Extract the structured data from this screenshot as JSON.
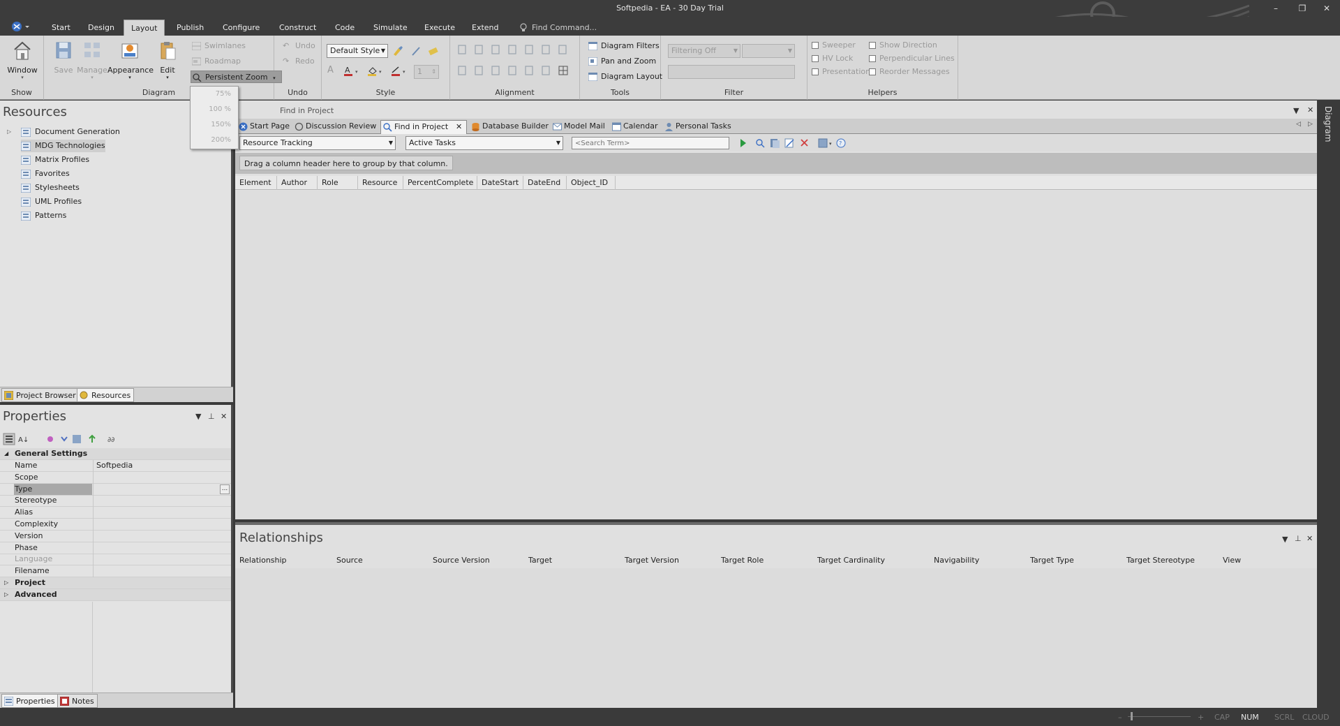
{
  "window": {
    "title": "Softpedia - EA - 30 Day Trial",
    "minimize": "–",
    "restore": "❐",
    "close": "✕"
  },
  "ribbon_tabs": [
    "Start",
    "Design",
    "Layout",
    "Publish",
    "Configure",
    "Construct",
    "Code",
    "Simulate",
    "Execute",
    "Extend"
  ],
  "find_command": "Find Command...",
  "ribbon": {
    "show": {
      "window": "Window",
      "label": "Show"
    },
    "diagram": {
      "save": "Save",
      "manage": "Manage",
      "appearance": "Appearance",
      "edit": "Edit",
      "swimlanes": "Swimlanes",
      "roadmap": "Roadmap",
      "persistent_zoom": "Persistent Zoom",
      "label": "Diagram"
    },
    "undo": {
      "undo": "Undo",
      "redo": "Redo",
      "label": "Undo"
    },
    "style": {
      "default_style": "Default Style",
      "size_value": "1",
      "label": "Style"
    },
    "alignment": {
      "label": "Alignment"
    },
    "tools": {
      "diagram_filters": "Diagram Filters",
      "pan_zoom": "Pan and Zoom",
      "diagram_layout": "Diagram Layout",
      "label": "Tools"
    },
    "filter": {
      "filtering": "Filtering Off",
      "label": "Filter"
    },
    "helpers": {
      "sweeper": "Sweeper",
      "hv_lock": "HV Lock",
      "presentation": "Presentation",
      "show_direction": "Show Direction",
      "perpendicular_lines": "Perpendicular Lines",
      "reorder_messages": "Reorder Messages",
      "label": "Helpers"
    }
  },
  "zoom_menu": [
    "75%",
    "100 %",
    "150%",
    "200%"
  ],
  "resources": {
    "title": "Resources",
    "items": [
      "Document Generation",
      "MDG Technologies",
      "Matrix Profiles",
      "Favorites",
      "Stylesheets",
      "UML Profiles",
      "Patterns"
    ],
    "tabs": [
      "Project Browser",
      "Resources"
    ]
  },
  "properties": {
    "title": "Properties",
    "general": "General Settings",
    "rows": [
      {
        "k": "Name",
        "v": "Softpedia"
      },
      {
        "k": "Scope",
        "v": ""
      },
      {
        "k": "Type",
        "v": ""
      },
      {
        "k": "Stereotype",
        "v": ""
      },
      {
        "k": "Alias",
        "v": ""
      },
      {
        "k": "Complexity",
        "v": ""
      },
      {
        "k": "Version",
        "v": ""
      },
      {
        "k": "Phase",
        "v": ""
      },
      {
        "k": "Language",
        "v": ""
      },
      {
        "k": "Filename",
        "v": ""
      }
    ],
    "project": "Project",
    "advanced": "Advanced",
    "ellipsis": "...",
    "tabs": [
      "Properties",
      "Notes"
    ]
  },
  "main": {
    "find_label": "Find in Project",
    "doc_tabs": [
      "Start Page",
      "Discussion Review",
      "Find in Project",
      "Database Builder",
      "Model Mail",
      "Calendar",
      "Personal Tasks"
    ],
    "search_category": "Resource Tracking",
    "search_query": "Active Tasks",
    "search_term_placeholder": "<Search Term>",
    "group_hint": "Drag a column header here to group by that column.",
    "columns": [
      "Element",
      "Author",
      "Role",
      "Resource",
      "PercentComplete",
      "DateStart",
      "DateEnd",
      "Object_ID"
    ]
  },
  "relationships": {
    "title": "Relationships",
    "columns": [
      "Relationship",
      "Source",
      "Source Version",
      "Target",
      "Target Version",
      "Target Role",
      "Target Cardinality",
      "Navigability",
      "Target Type",
      "Target Stereotype",
      "View"
    ]
  },
  "right_sidebar": "Diagram",
  "status": {
    "cap": "CAP",
    "num": "NUM",
    "scrl": "SCRL",
    "cloud": "CLOUD",
    "minus": "–",
    "plus": "+"
  },
  "colors": {
    "accent_blue": "#3a6fc4",
    "ribbon_bg": "#d8d8d8",
    "chrome_dark": "#3c3c3c"
  }
}
